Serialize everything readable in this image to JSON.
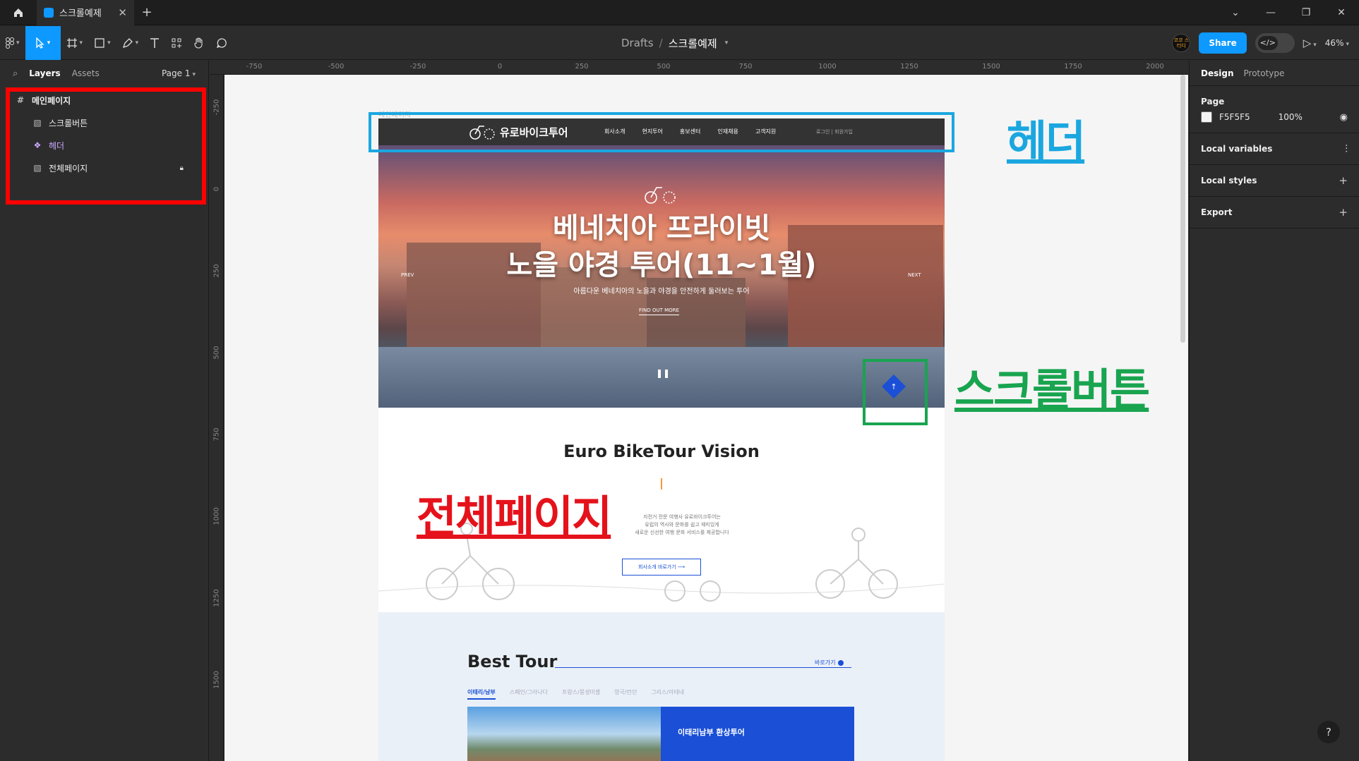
{
  "titlebar": {
    "tab_title": "스크롤예제",
    "close_glyph": "✕",
    "new_tab_glyph": "+",
    "window_controls": [
      "⌄",
      "—",
      "❐",
      "✕"
    ]
  },
  "toolbar": {
    "breadcrumb_drafts": "Drafts",
    "breadcrumb_sep": "/",
    "file_name": "스크롤예제",
    "avatar_text": "코코 스터디",
    "share_label": "Share",
    "dev_mode_glyph": "</>",
    "zoom": "46%"
  },
  "left_panel": {
    "layers_tab": "Layers",
    "assets_tab": "Assets",
    "page_selector": "Page 1",
    "layers": [
      {
        "name": "메인페이지",
        "type": "frame"
      },
      {
        "name": "스크롤버튼",
        "type": "image"
      },
      {
        "name": "헤더",
        "type": "component"
      },
      {
        "name": "전체페이지",
        "type": "image",
        "locked": true
      }
    ]
  },
  "rulers": {
    "top": [
      "-750",
      "-500",
      "-250",
      "0",
      "250",
      "500",
      "750",
      "1000",
      "1250",
      "1500",
      "1750",
      "2000"
    ],
    "left": [
      "-250",
      "0",
      "250",
      "500",
      "750",
      "1000",
      "1250",
      "1500"
    ]
  },
  "site": {
    "frame_label": "메인페이지",
    "logo_text": "유로바이크투어",
    "nav": [
      "회사소개",
      "현지투어",
      "홍보센터",
      "인재채용",
      "고객지원"
    ],
    "login": "로그인 | 회원가입",
    "hero_title_1": "베네치아 프라이빗",
    "hero_title_2": "노을 야경 투어(11~1월)",
    "hero_sub": "아름다운 베네치아의 노을과 야경을 안전하게 둘러보는 투어",
    "hero_btn": "FIND OUT MORE",
    "prev": "PREV",
    "next": "NEXT",
    "pause": "❚❚",
    "scroll_arrow": "↑",
    "vision_title": "Euro BikeTour Vision",
    "vision_text_1": "자전거 전문 여행사 유로바이크투어는",
    "vision_text_2": "유럽의 역사와 문화를 쉽고 재미있게",
    "vision_text_3": "새로운 신선한 여행 문화 서비스를 제공합니다",
    "vision_btn": "회사소개 바로가기 ⟶",
    "best_title": "Best Tour",
    "best_more": "바로가기",
    "best_tabs": [
      "이태리/남부",
      "스페인/그라나다",
      "프랑스/몽생미셸",
      "영국/런던",
      "그리스/아테네"
    ],
    "best_card_title": "이태리남부 환상투어"
  },
  "annotations": {
    "header_label": "헤더",
    "scroll_label": "스크롤버튼",
    "fullpage_label": "전체페이지"
  },
  "right_panel": {
    "design_tab": "Design",
    "prototype_tab": "Prototype",
    "page_section": "Page",
    "page_color": "F5F5F5",
    "page_opacity": "100%",
    "local_variables": "Local variables",
    "local_styles": "Local styles",
    "export": "Export",
    "help": "?"
  },
  "colors": {
    "accent": "#0d99ff",
    "site_blue": "#1a4fd6",
    "header_anno": "#1aa7e0",
    "scroll_anno": "#19a450",
    "fullpage_anno": "#e5121b",
    "page_bg": "#F5F5F5"
  }
}
